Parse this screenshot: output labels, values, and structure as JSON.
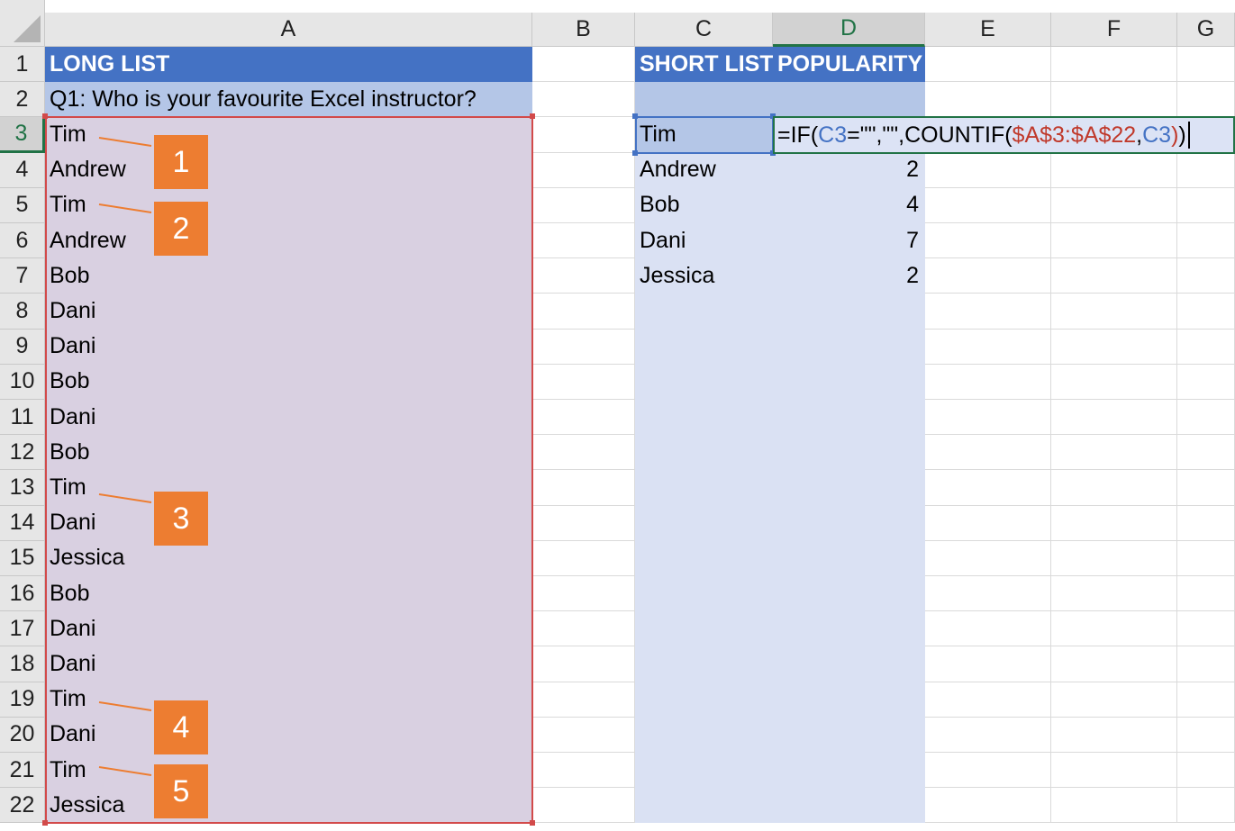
{
  "columns": [
    "A",
    "B",
    "C",
    "D",
    "E",
    "F",
    "G"
  ],
  "rows": [
    "1",
    "2",
    "3",
    "4",
    "5",
    "6",
    "7",
    "8",
    "9",
    "10",
    "11",
    "12",
    "13",
    "14",
    "15",
    "16",
    "17",
    "18",
    "19",
    "20",
    "21",
    "22"
  ],
  "cells": {
    "A1": "LONG LIST",
    "A2": "Q1: Who is your favourite Excel instructor?",
    "C1": "SHORT LIST",
    "D1": "POPULARITY",
    "long_list": [
      "Tim",
      "Andrew",
      "Tim",
      "Andrew",
      "Bob",
      "Dani",
      "Dani",
      "Bob",
      "Dani",
      "Bob",
      "Tim",
      "Dani",
      "Jessica",
      "Bob",
      "Dani",
      "Dani",
      "Tim",
      "Dani",
      "Tim",
      "Jessica"
    ],
    "short_list": [
      "Tim",
      "Andrew",
      "Bob",
      "Dani",
      "Jessica"
    ],
    "popularity": [
      "",
      "2",
      "4",
      "7",
      "2"
    ]
  },
  "formula": {
    "prefix": "=IF(",
    "ref1": "C3",
    "mid": "=\"\",\"\",COUNTIF(",
    "range": "$A$3:$A$22",
    "comma": ",",
    "ref2": "C3",
    "close_inner": ")",
    "close_outer": ")"
  },
  "callouts": [
    "1",
    "2",
    "3",
    "4",
    "5"
  ],
  "colors": {
    "header_blue": "#4472c4",
    "light_blue": "#b4c6e7",
    "pale_blue": "#dae1f3",
    "mauve": "#d9d0e1",
    "range_red": "#d24a4a",
    "callout_orange": "#ed7d31",
    "select_green": "#217346",
    "ref_blue": "#4472c4"
  }
}
